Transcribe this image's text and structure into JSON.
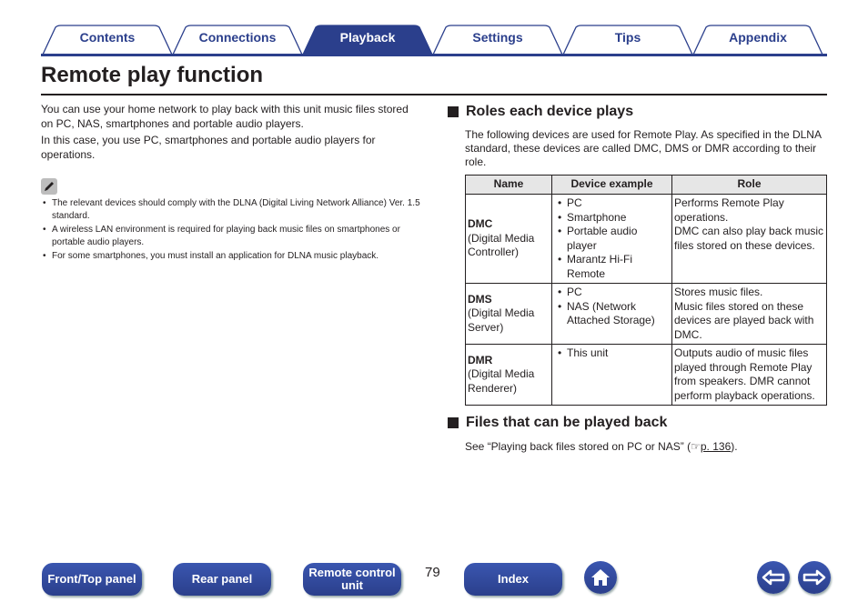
{
  "tabs": [
    {
      "label": "Contents",
      "active": false
    },
    {
      "label": "Connections",
      "active": false
    },
    {
      "label": "Playback",
      "active": true
    },
    {
      "label": "Settings",
      "active": false
    },
    {
      "label": "Tips",
      "active": false
    },
    {
      "label": "Appendix",
      "active": false
    }
  ],
  "page_title": "Remote play function",
  "intro": [
    "You can use your home network to play back with this unit music files stored on PC, NAS, smartphones and portable audio players.",
    "In this case, you use PC, smartphones and portable audio players for operations."
  ],
  "notes": [
    "The relevant devices should comply with the DLNA (Digital Living Network Alliance) Ver. 1.5 standard.",
    "A wireless LAN environment is required for playing back music files on smartphones or portable audio players.",
    "For some smartphones, you must install an application for DLNA music playback."
  ],
  "roles": {
    "heading": "Roles each device plays",
    "description": "The following devices are used for Remote Play. As specified in the DLNA standard, these devices are called DMC, DMS or DMR according to their role.",
    "columns": [
      "Name",
      "Device example",
      "Role"
    ],
    "rows": [
      {
        "abbr": "DMC",
        "full": "(Digital Media Controller)",
        "devices": [
          "PC",
          "Smartphone",
          "Portable audio player",
          "Marantz Hi-Fi Remote"
        ],
        "role": [
          "Performs Remote Play operations.",
          "DMC can also play back music files stored on these devices."
        ]
      },
      {
        "abbr": "DMS",
        "full": "(Digital Media Server)",
        "devices": [
          "PC",
          "NAS (Network Attached Storage)"
        ],
        "role": [
          "Stores music files.",
          "Music files stored on these devices are played back with DMC."
        ]
      },
      {
        "abbr": "DMR",
        "full": "(Digital Media Renderer)",
        "devices": [
          "This unit"
        ],
        "role": [
          "Outputs audio of music files played through Remote Play from speakers. DMR cannot perform playback operations."
        ]
      }
    ]
  },
  "files": {
    "heading": "Files that can be played back",
    "text_before": "See “Playing back files stored on PC or NAS” (",
    "link": "p. 136",
    "text_after": ")."
  },
  "footer": {
    "front_top": "Front/Top panel",
    "rear": "Rear panel",
    "remote": "Remote control unit",
    "page_number": "79",
    "index": "Index"
  },
  "colors": {
    "accent": "#2b3f8c",
    "header_bg": "#e6e6e6"
  }
}
